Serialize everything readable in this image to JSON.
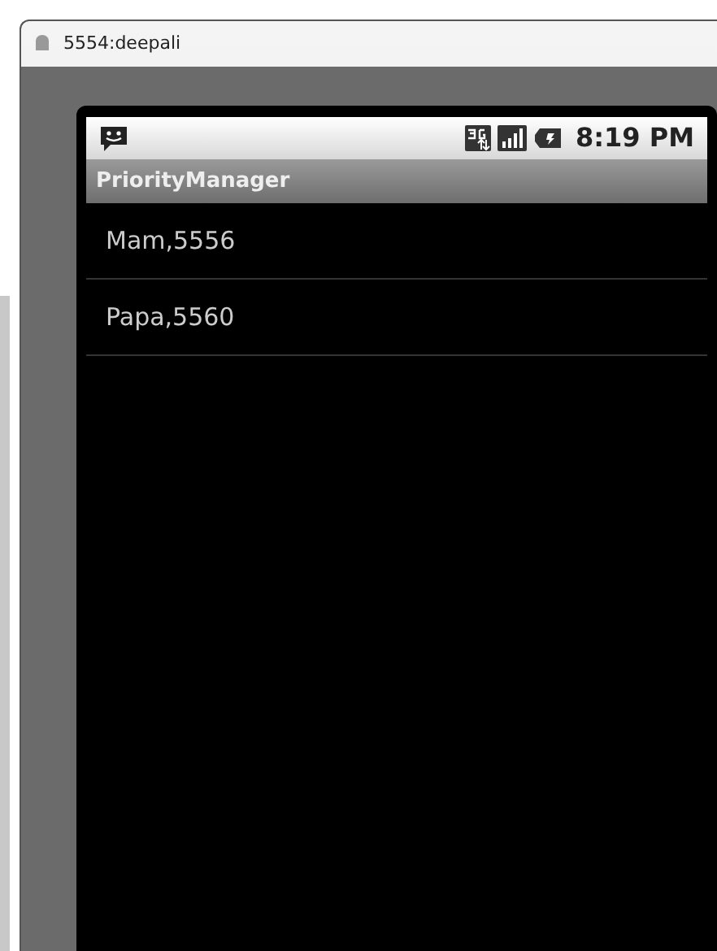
{
  "window": {
    "title": "5554:deepali"
  },
  "status_bar": {
    "time": "8:19 PM"
  },
  "app": {
    "title": "PriorityManager"
  },
  "list": [
    {
      "label": "Mam,5556"
    },
    {
      "label": "Papa,5560"
    }
  ]
}
